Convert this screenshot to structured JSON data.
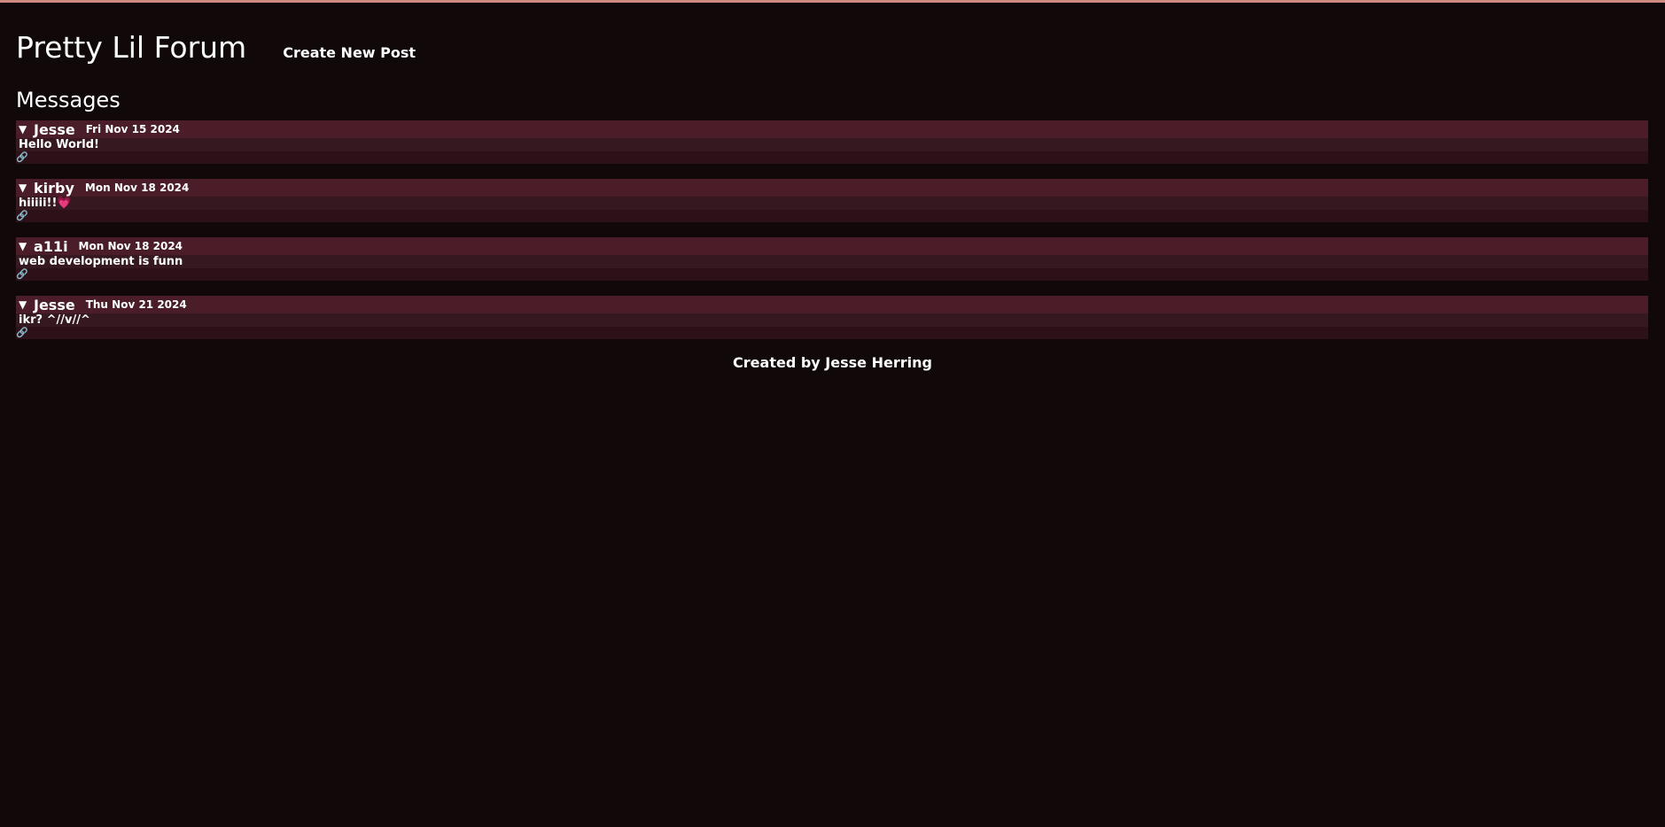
{
  "header": {
    "site_title": "Pretty Lil Forum",
    "create_post_label": "Create New Post"
  },
  "messages_section": {
    "title": "Messages",
    "items": [
      {
        "author": "Jesse",
        "date": "Fri Nov 15 2024",
        "body": "Hello World!",
        "link_icon": "link-icon"
      },
      {
        "author": "kirby",
        "date": "Mon Nov 18 2024",
        "body": "hiiiii!!💗",
        "link_icon": "link-icon"
      },
      {
        "author": "a11i",
        "date": "Mon Nov 18 2024",
        "body": "web development is funn",
        "link_icon": "link-icon"
      },
      {
        "author": "Jesse",
        "date": "Thu Nov 21 2024",
        "body": "ikr? ^//v//^",
        "link_icon": "link-icon"
      }
    ]
  },
  "footer": {
    "text": "Created by Jesse Herring"
  },
  "colors": {
    "background": "#100809",
    "top_border": "#d18a80",
    "message_header": "#4a1d29",
    "message_body": "#2c1218"
  }
}
